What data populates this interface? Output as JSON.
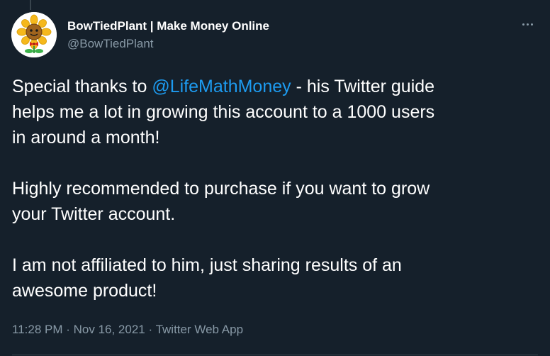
{
  "tweet": {
    "author": {
      "display_name": "BowTiedPlant | Make Money Online",
      "handle": "@BowTiedPlant",
      "avatar_icon": "sunflower-avatar-icon"
    },
    "more_icon": "more-options-icon",
    "text": {
      "p1_before": "Special thanks to ",
      "p1_mention": "@LifeMathMoney",
      "p1_line1_after": " - his Twitter guide",
      "p1_line2": "helps me a lot in growing this account to a 1000 users",
      "p1_line3": "in around a month!",
      "p2_line1": "Highly recommended to purchase if you want to grow",
      "p2_line2": "your Twitter account.",
      "p3_line1": "I am not affiliated to him, just sharing results of an",
      "p3_line2": "awesome product!"
    },
    "meta": {
      "time": "11:28 PM",
      "separator": " · ",
      "date": "Nov 16, 2021",
      "source": "Twitter Web App"
    }
  },
  "colors": {
    "background": "#15202b",
    "text": "#ffffff",
    "secondary": "#8899a6",
    "link": "#1d9bf0"
  }
}
